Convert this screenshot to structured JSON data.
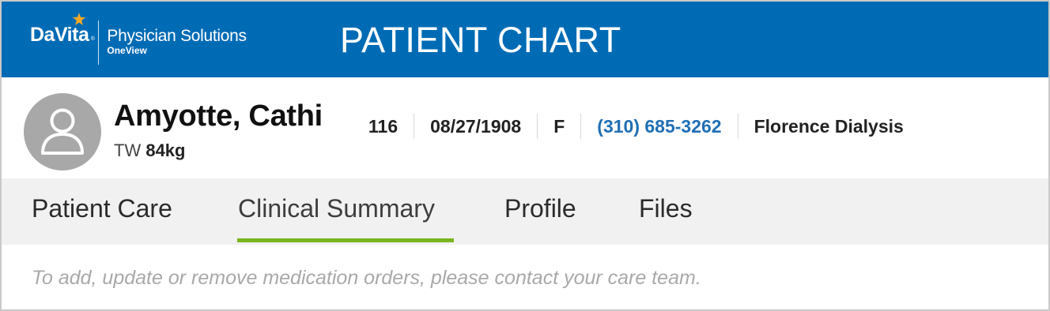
{
  "header": {
    "brand": "DaVita",
    "brand_registered": "®",
    "product": "Physician Solutions",
    "product_sub": "OneView",
    "page_title": "PATIENT CHART",
    "colors": {
      "bar": "#006bb5",
      "star": "#f7a823"
    },
    "icons": {
      "logo_star": "star-icon"
    }
  },
  "patient": {
    "name": "Amyotte, Cathi",
    "weight_label": "TW",
    "weight_value": "84kg",
    "id": "116",
    "dob": "08/27/1908",
    "sex": "F",
    "phone": "(310) 685-3262",
    "facility": "Florence Dialysis",
    "avatar_icon": "user-avatar-icon",
    "colors": {
      "phone": "#1f6fb5",
      "avatar": "#a8a8a8"
    }
  },
  "tabs": {
    "items": [
      {
        "label": "Patient Care"
      },
      {
        "label": "Clinical Summary"
      },
      {
        "label": "Profile"
      },
      {
        "label": "Files"
      }
    ],
    "active_index": 1,
    "colors": {
      "active_underline": "#7ab51d",
      "bar": "#f1f1f1"
    }
  },
  "notice": {
    "text": "To add, update or remove medication orders, please contact your care team."
  }
}
